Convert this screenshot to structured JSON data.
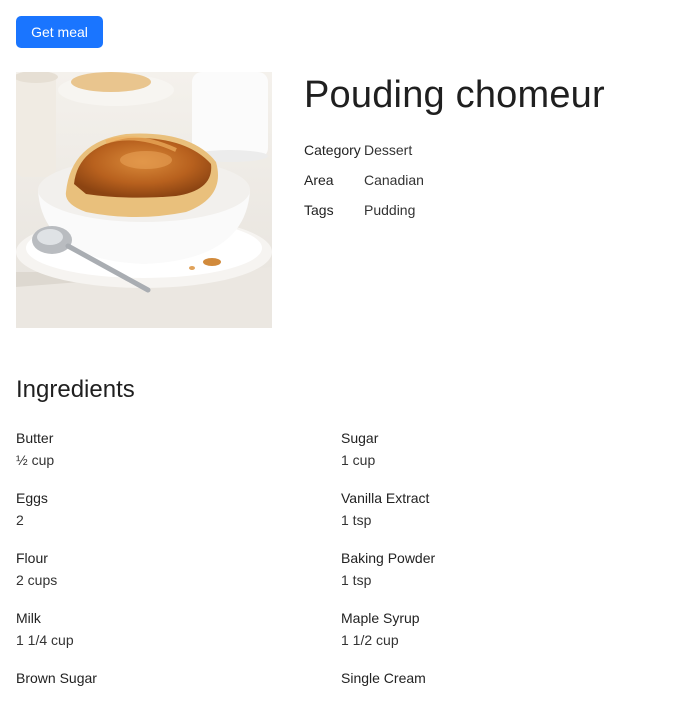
{
  "actions": {
    "get_meal_label": "Get meal"
  },
  "meal": {
    "name": "Pouding chomeur",
    "category_label": "Category",
    "category": "Dessert",
    "area_label": "Area",
    "area": "Canadian",
    "tags_label": "Tags",
    "tags": "Pudding",
    "image_alt": "Pouding chomeur"
  },
  "ingredients": {
    "heading": "Ingredients",
    "items": [
      {
        "name": "Butter",
        "measure": "½ cup"
      },
      {
        "name": "Sugar",
        "measure": "1 cup"
      },
      {
        "name": "Eggs",
        "measure": "2"
      },
      {
        "name": "Vanilla Extract",
        "measure": "1 tsp"
      },
      {
        "name": "Flour",
        "measure": "2 cups"
      },
      {
        "name": "Baking Powder",
        "measure": "1 tsp"
      },
      {
        "name": "Milk",
        "measure": "1 1/4 cup"
      },
      {
        "name": "Maple Syrup",
        "measure": "1 1/2 cup"
      },
      {
        "name": "Brown Sugar",
        "measure": ""
      },
      {
        "name": "Single Cream",
        "measure": ""
      }
    ]
  }
}
